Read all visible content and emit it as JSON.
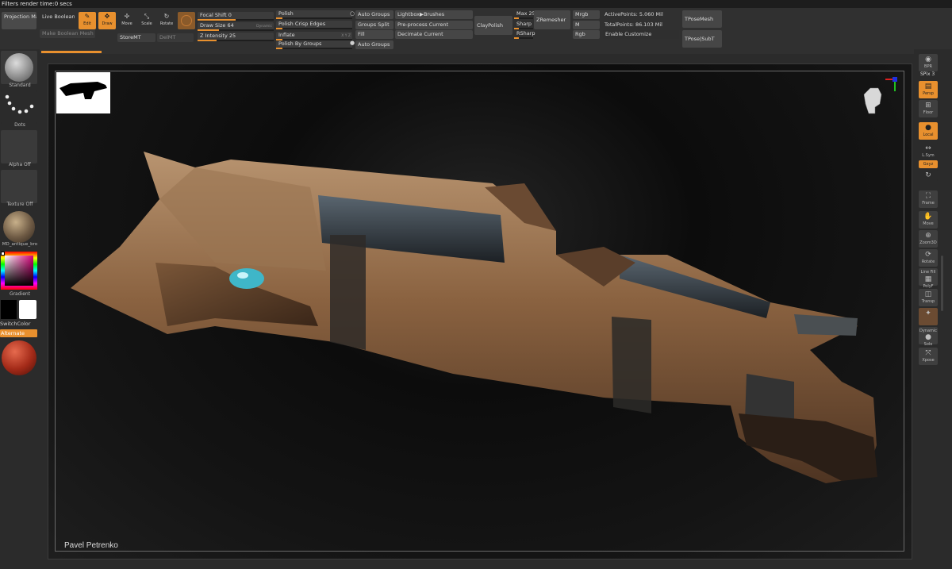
{
  "status_text": "Filters render time:0 secs",
  "topbar": {
    "projection_master": "Projection Master",
    "live_boolean": "Live Boolean",
    "make_boolean_mesh": "Make Boolean Mesh",
    "tools": {
      "edit": "Edit",
      "draw": "Draw",
      "move": "Move",
      "scale": "Scale",
      "rotate": "Rotate"
    },
    "store_mt": "StoreMT",
    "del_mt": "DelMT",
    "focal_shift": "Focal Shift 0",
    "draw_size": "Draw Size 64",
    "dynamic": "Dynamic",
    "z_intensity": "Z Intensity 25",
    "polish": "Polish",
    "polish_crisp_edges": "Polish Crisp Edges",
    "inflate": "Inflate",
    "xyz": "X Y Z",
    "polish_by_groups": "Polish By Groups",
    "auto_groups_1": "Auto Groups",
    "groups_split": "Groups Split",
    "fill": "Fill",
    "auto_groups_2": "Auto Groups",
    "lightbox_brushes": "Lightbox▶Brushes",
    "preprocess_current": "Pre-process Current",
    "decimate_current": "Decimate Current",
    "claypolish": "ClayPolish",
    "max": "Max 25",
    "sharp": "Sharp",
    "rsharp": "RSharp",
    "zremesher": "ZRemesher",
    "mrgb": "Mrgb",
    "m": "M",
    "rgb": "Rgb",
    "active_points": "ActivePoints: 5.060 Mil",
    "total_points": "TotalPoints: 86.103 Mil",
    "enable_customize": "Enable Customize",
    "tpose_mesh": "TPoseMesh",
    "tpose_subt": "TPose|SubT",
    "focal_shift_level": 0.5,
    "draw_size_level": 0.28,
    "z_intensity_level": 0.25,
    "max_level": 0.25
  },
  "left": {
    "standard": "Standard",
    "dots": "Dots",
    "alpha_off": "Alpha Off",
    "texture_off": "Texture Off",
    "material": "MD_antique_bro",
    "gradient": "Gradient",
    "switch_color": "SwitchColor",
    "alternate": "Alternate"
  },
  "right": {
    "bpr": "BPR",
    "spix": "SPix 3",
    "persp": "Persp",
    "floor": "Floor",
    "local": "Local",
    "lsym": "L.Sym",
    "gxyz": "Gxyz",
    "frame": "Frame",
    "move": "Move",
    "zoom3d": "Zoom3D",
    "rotate": "Rotate",
    "line_fill": "Line Fill",
    "polyf": "PolyF",
    "transp": "Transp",
    "dynamic": "Dynamic",
    "solo": "Solo",
    "xpose": "Xpose"
  },
  "viewport": {
    "signature": "Pavel Petrenko"
  },
  "colors": {
    "accent": "#e8902e",
    "bg": "#2b2b2b"
  }
}
